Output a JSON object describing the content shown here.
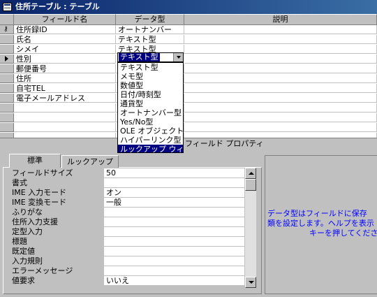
{
  "window": {
    "title": "住所テーブル : テーブル"
  },
  "columns": {
    "field_name": "フィールド名",
    "data_type": "データ型",
    "description": "説明"
  },
  "rows": [
    {
      "field": "住所録ID",
      "type": "オートナンバー",
      "key": true
    },
    {
      "field": "氏名",
      "type": "テキスト型"
    },
    {
      "field": "シメイ",
      "type": "テキスト型"
    },
    {
      "field": "性別",
      "type": "テキスト型",
      "current": true
    },
    {
      "field": "郵便番号",
      "type": ""
    },
    {
      "field": "住所",
      "type": ""
    },
    {
      "field": "自宅TEL",
      "type": ""
    },
    {
      "field": "電子メールアドレス",
      "type": ""
    },
    {
      "field": "",
      "type": ""
    },
    {
      "field": "",
      "type": ""
    },
    {
      "field": "",
      "type": ""
    },
    {
      "field": "",
      "type": ""
    }
  ],
  "dropdown": {
    "selected": "テキスト型",
    "options": [
      "テキスト型",
      "メモ型",
      "数値型",
      "日付/時刻型",
      "通貨型",
      "オートナンバー型",
      "Yes/No型",
      "OLE オブジェクト型",
      "ハイパーリンク型",
      "ルックアップ ウィ"
    ],
    "highlighted_index": 9
  },
  "field_properties_label": "フィールド プロパティ",
  "tabs": [
    "標準",
    "ルックアップ"
  ],
  "properties": [
    {
      "label": "フィールドサイズ",
      "value": "50"
    },
    {
      "label": "書式",
      "value": ""
    },
    {
      "label": "IME 入力モード",
      "value": "オン"
    },
    {
      "label": "IME 変換モード",
      "value": "一般"
    },
    {
      "label": "ふりがな",
      "value": ""
    },
    {
      "label": "住所入力支援",
      "value": ""
    },
    {
      "label": "定型入力",
      "value": ""
    },
    {
      "label": "標題",
      "value": ""
    },
    {
      "label": "既定値",
      "value": ""
    },
    {
      "label": "入力規則",
      "value": ""
    },
    {
      "label": "エラーメッセージ",
      "value": ""
    },
    {
      "label": "値要求",
      "value": "いいえ"
    }
  ],
  "help_lines": [
    "データ型はフィールドに保存",
    "類を設定します。ヘルプを表示",
    "キーを押してくださ"
  ],
  "colors": {
    "title_bar": "#0a246a",
    "selection": "#000080",
    "help_text": "#0000ff"
  }
}
